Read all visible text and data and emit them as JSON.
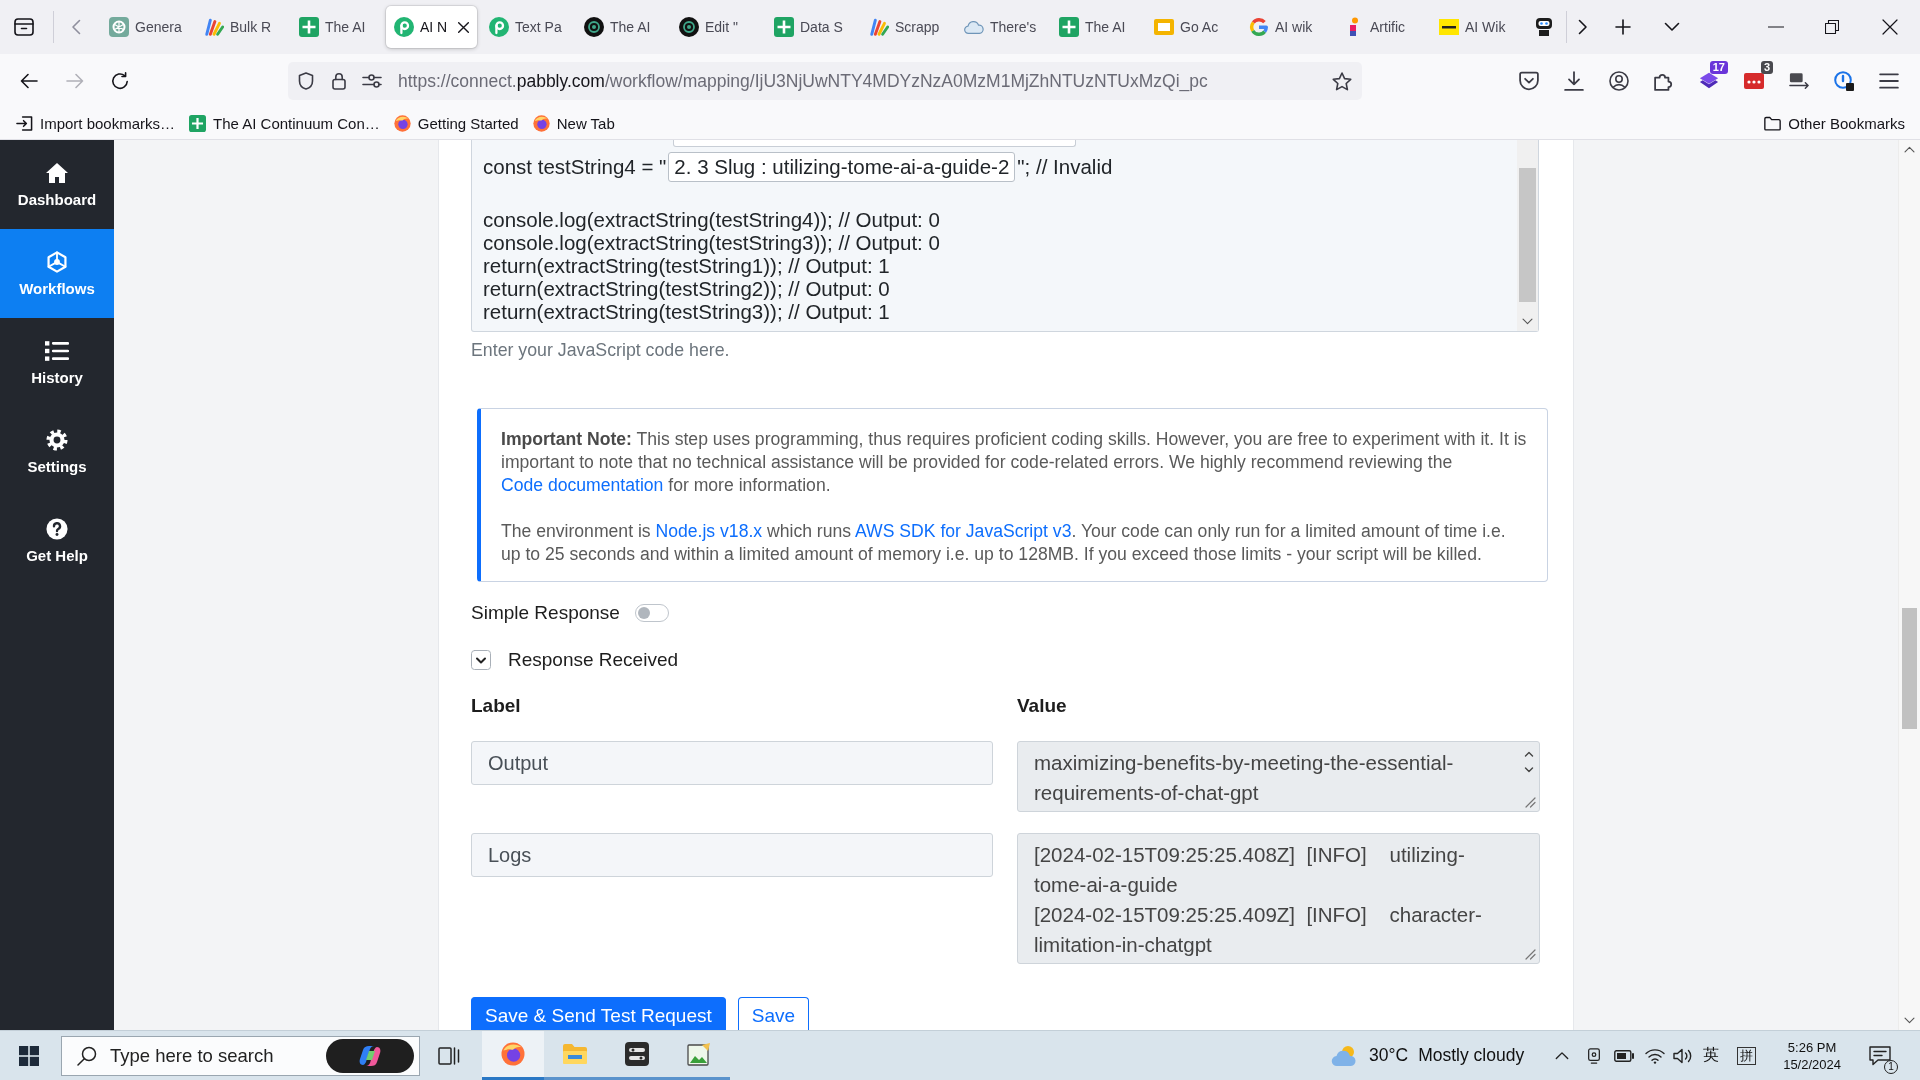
{
  "browser": {
    "tabs": [
      {
        "title": "Genera",
        "selected": false
      },
      {
        "title": "Bulk R",
        "selected": false
      },
      {
        "title": "The AI",
        "selected": false
      },
      {
        "title": "AI N",
        "selected": true
      },
      {
        "title": "Text Pa",
        "selected": false
      },
      {
        "title": "The AI",
        "selected": false
      },
      {
        "title": "Edit \"",
        "selected": false
      },
      {
        "title": "Data S",
        "selected": false
      },
      {
        "title": "Scrapp",
        "selected": false
      },
      {
        "title": "There's",
        "selected": false
      },
      {
        "title": "The AI",
        "selected": false
      },
      {
        "title": "Go Ac",
        "selected": false
      },
      {
        "title": "AI wik",
        "selected": false
      },
      {
        "title": "Artific",
        "selected": false
      },
      {
        "title": "AI Wik",
        "selected": false
      },
      {
        "selected": false
      }
    ],
    "address": {
      "url_start": "https://connect.",
      "domain": "pabbly.com",
      "url_rest": "/workflow/mapping/IjU3NjUwNTY4MDYzNzA0MzM1MjZhNTUzNTUxMzQi_pc"
    },
    "extension_badges": [
      "17",
      "3"
    ],
    "bookmarks": [
      "Import bookmarks…",
      "The AI Continuum Con…",
      "Getting Started",
      "New Tab"
    ],
    "other_bookmarks": "Other Bookmarks"
  },
  "sidebar": {
    "items": [
      {
        "label": "Dashboard",
        "selected": false
      },
      {
        "label": "Workflows",
        "selected": true
      },
      {
        "label": "History",
        "selected": false
      },
      {
        "label": "Settings",
        "selected": false
      },
      {
        "label": "Get Help",
        "selected": false
      }
    ]
  },
  "code_editor": {
    "token_line": {
      "before": "const testString4 = \"",
      "token": "2. 3 Slug : utilizing-tome-ai-a-guide-2",
      "after": "\"; // Invalid"
    },
    "lines": [
      "console.log(extractString(testString4)); // Output: 0",
      "console.log(extractString(testString3)); // Output: 0",
      "return(extractString(testString1)); // Output: 1",
      "return(extractString(testString2)); // Output: 0",
      "return(extractString(testString3)); // Output: 1"
    ],
    "hint": "Enter your JavaScript code here."
  },
  "note": {
    "paragraphs": [
      [
        {
          "kind": "text",
          "text": "**Important Note:** This step uses programming, thus requires proficient coding skills. However, you are free to experiment with it. It is important to note that no technical assistance will be provided for code-related errors. We highly recommend reviewing the "
        },
        {
          "kind": "link",
          "text": "Code documentation"
        },
        {
          "kind": "text",
          "text": " for more information."
        }
      ],
      [
        {
          "kind": "text",
          "text": "The environment is "
        },
        {
          "kind": "link",
          "text": "Node.js v18.x"
        },
        {
          "kind": "text",
          "text": " which runs "
        },
        {
          "kind": "link",
          "text": "AWS SDK for JavaScript v3"
        },
        {
          "kind": "text",
          "text": ". Your code can only run for a limited amount of time i.e. up to 25 seconds and within a limited amount of memory i.e. up to 128MB. If you exceed those limits - your script will be killed."
        }
      ]
    ]
  },
  "simple_response": {
    "label": "Simple Response",
    "on": false
  },
  "response": {
    "title": "Response Received",
    "expanded": true,
    "columns": [
      "Label",
      "Value"
    ],
    "rows": [
      {
        "label": "Output",
        "value": "maximizing-benefits-by-meeting-the-essential-requirements-of-chat-gpt"
      },
      {
        "label": "Logs",
        "value": "[2024-02-15T09:25:25.408Z]  [INFO]    utilizing-tome-ai-a-guide\n[2024-02-15T09:25:25.409Z]  [INFO]    character-limitation-in-chatgpt"
      }
    ]
  },
  "buttons": [
    {
      "label": "Save & Send Test Request",
      "kind": "primary"
    },
    {
      "label": "Save",
      "kind": "outline"
    }
  ],
  "taskbar": {
    "search": {
      "placeholder": "Type here to search"
    },
    "apps": [
      {
        "selected": true
      },
      {
        "selected": false
      },
      {
        "selected": false
      },
      {
        "selected": false
      }
    ],
    "weather": {
      "temperature": "30°C",
      "condition": "Mostly cloudy"
    },
    "input_language": "英",
    "input_mode": "拼",
    "time": "5:26 PM",
    "date": "15/2/2024",
    "notifications": "1"
  }
}
